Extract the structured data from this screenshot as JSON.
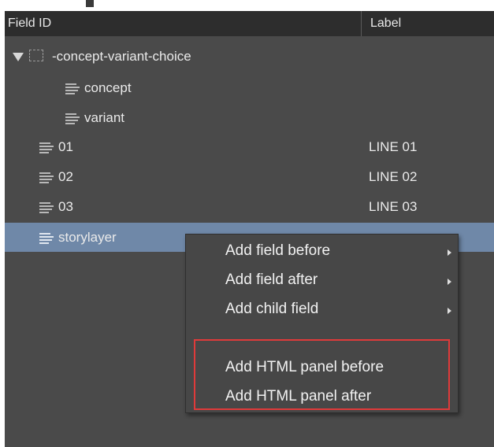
{
  "header": {
    "field_id": "Field ID",
    "label": "Label"
  },
  "rows": [
    {
      "name": "-concept-variant-choice",
      "label": ""
    },
    {
      "name": "concept",
      "label": ""
    },
    {
      "name": "variant",
      "label": ""
    },
    {
      "name": "01",
      "label": "LINE 01"
    },
    {
      "name": "02",
      "label": "LINE 02"
    },
    {
      "name": "03",
      "label": "LINE 03"
    },
    {
      "name": "storylayer",
      "label": ""
    }
  ],
  "context_menu": {
    "items": [
      {
        "label": "Add field before"
      },
      {
        "label": "Add field after"
      },
      {
        "label": "Add child field"
      },
      {
        "label": "Add HTML panel before"
      },
      {
        "label": "Add HTML panel after"
      }
    ]
  },
  "colors": {
    "background": "#4a4a4a",
    "header": "#2d2d2d",
    "selected_row": "#6f88a8",
    "highlight": "#e03a3a"
  }
}
